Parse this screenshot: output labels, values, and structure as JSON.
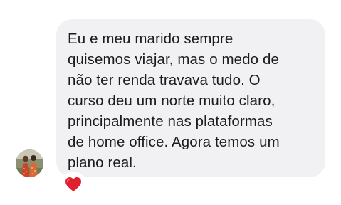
{
  "chat": {
    "message": {
      "lines": [
        "Eu e meu marido sempre",
        "quisemos viajar, mas o medo de",
        "não ter renda travava tudo. O",
        "curso deu um norte muito claro,",
        "principalmente nas plataformas",
        "de home office. Agora temos um",
        "plano real."
      ],
      "bubble_color": "#f1f1f4",
      "text_color": "#1c1c1e"
    },
    "sender": {
      "avatar_icon": "profile-photo-couple"
    },
    "reaction": {
      "icon": "red-heart-icon",
      "color": "#e0202e"
    }
  }
}
